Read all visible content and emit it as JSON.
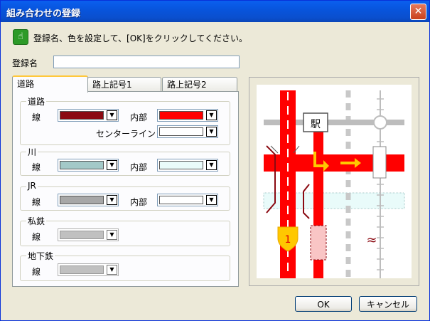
{
  "window": {
    "title": "組み合わせの登録",
    "close_symbol": "✕"
  },
  "instruction": "登録名、色を設定して、[OK]をクリックしてください。",
  "hint_icon": "hand-icon",
  "name_field": {
    "label": "登録名",
    "value": ""
  },
  "tabs": [
    {
      "label": "道路",
      "active": true
    },
    {
      "label": "路上記号1",
      "active": false
    },
    {
      "label": "路上記号2",
      "active": false
    }
  ],
  "groups": {
    "road": {
      "title": "道路",
      "line_label": "線",
      "inner_label": "内部",
      "center_label": "センターライン",
      "line_color": "#8B0A12",
      "inner_color": "#FF0000",
      "center_color": "#FFFFFF"
    },
    "river": {
      "title": "川",
      "line_label": "線",
      "inner_label": "内部",
      "line_color": "#A3C9C8",
      "inner_color": "#E9FBFA"
    },
    "jr": {
      "title": "JR",
      "line_label": "線",
      "inner_label": "内部",
      "line_color": "#A7A7A7",
      "inner_color": "#FFFFFF"
    },
    "private_rail": {
      "title": "私鉄",
      "line_label": "線",
      "line_color": "#C0C0C0"
    },
    "subway": {
      "title": "地下鉄",
      "line_label": "線",
      "line_color": "#C0C0C0"
    }
  },
  "preview": {
    "station_label": "駅",
    "route_number": "1",
    "river_symbol": "≈"
  },
  "buttons": {
    "ok": "OK",
    "cancel": "キャンセル"
  },
  "colors": {
    "title_bar": "#0A5FEF",
    "road_red": "#FF0000",
    "road_edge": "#8B0A12",
    "route_badge": "#FFC800"
  }
}
